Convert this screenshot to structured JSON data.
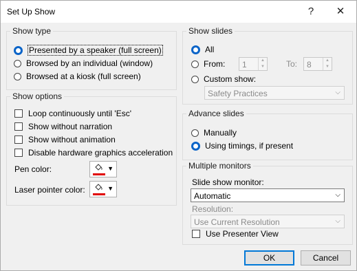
{
  "window": {
    "title": "Set Up Show",
    "help_glyph": "?",
    "close_glyph": "✕"
  },
  "show_type": {
    "label": "Show type",
    "options": [
      {
        "text": "Presented by a speaker (full screen)",
        "selected": true
      },
      {
        "text": "Browsed by an individual (window)",
        "selected": false
      },
      {
        "text": "Browsed at a kiosk (full screen)",
        "selected": false
      }
    ]
  },
  "show_options": {
    "label": "Show options",
    "checks": [
      {
        "text": "Loop continuously until 'Esc'",
        "checked": false
      },
      {
        "text": "Show without narration",
        "checked": false
      },
      {
        "text": "Show without animation",
        "checked": false
      },
      {
        "text": "Disable hardware graphics acceleration",
        "checked": false
      }
    ],
    "pen_color_label": "Pen color:",
    "laser_color_label": "Laser pointer color:",
    "pen_color": "#e00000",
    "laser_color": "#e00000"
  },
  "show_slides": {
    "label": "Show slides",
    "all_label": "All",
    "from_label": "From:",
    "from_value": "1",
    "to_label": "To:",
    "to_value": "8",
    "custom_label": "Custom show:",
    "custom_value": "Safety Practices"
  },
  "advance_slides": {
    "label": "Advance slides",
    "manually": "Manually",
    "timings": "Using timings, if present"
  },
  "monitors": {
    "label": "Multiple monitors",
    "monitor_label": "Slide show monitor:",
    "monitor_value": "Automatic",
    "resolution_label": "Resolution:",
    "resolution_value": "Use Current Resolution",
    "presenter_view": "Use Presenter View"
  },
  "buttons": {
    "ok": "OK",
    "cancel": "Cancel"
  },
  "colors": {
    "accent": "#0078d7",
    "radio_selected": "#0a64c8"
  }
}
